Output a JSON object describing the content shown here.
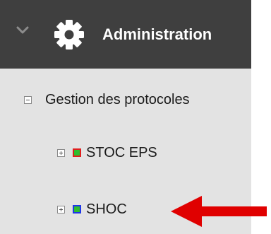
{
  "header": {
    "title": "Administration",
    "collapse_icon": "chevron-down-icon",
    "section_icon": "gear-icon"
  },
  "tree": {
    "root": {
      "label": "Gestion des protocoles",
      "state": "expanded",
      "icon": "collapse-minus-icon"
    },
    "children": [
      {
        "label": "STOC EPS",
        "state": "collapsed",
        "icon": "expand-plus-icon",
        "swatch_fill": "#2fbe2f",
        "swatch_border": "#e01e1e"
      },
      {
        "label": "SHOC",
        "state": "collapsed",
        "icon": "expand-plus-icon",
        "swatch_fill": "#2fbe2f",
        "swatch_border": "#1f37e8"
      }
    ]
  },
  "annotation": {
    "icon": "red-arrow-icon",
    "color": "#e00000"
  },
  "colors": {
    "header_bg": "#3f3f3f",
    "panel_bg": "#e3e3e3"
  }
}
